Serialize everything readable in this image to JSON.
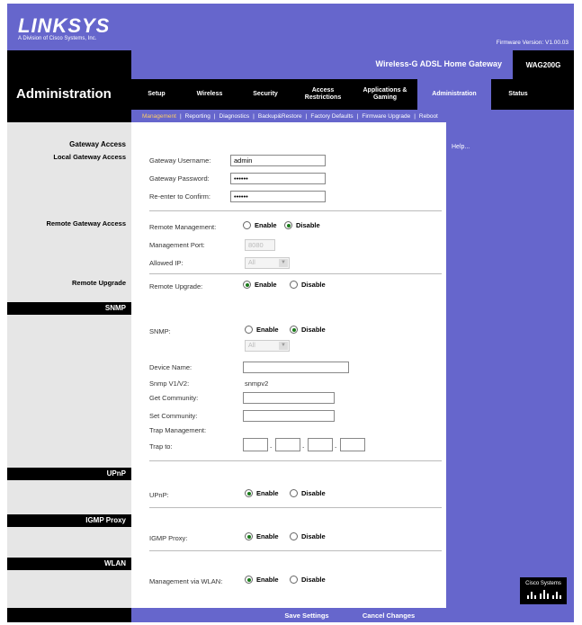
{
  "header": {
    "logo": "LINKSYS",
    "logo_sub": "A Division of Cisco Systems, Inc.",
    "firmware": "Firmware Version: V1.00.03",
    "product_name": "Wireless-G ADSL Home Gateway",
    "model": "WAG200G",
    "page_title": "Administration"
  },
  "tabs": [
    {
      "label": "Setup"
    },
    {
      "label": "Wireless"
    },
    {
      "label": "Security"
    },
    {
      "label": "Access Restrictions"
    },
    {
      "label": "Applications & Gaming"
    },
    {
      "label": "Administration"
    },
    {
      "label": "Status"
    }
  ],
  "subtabs": [
    {
      "label": "Management"
    },
    {
      "label": "Reporting"
    },
    {
      "label": "Diagnostics"
    },
    {
      "label": "Backup&Restore"
    },
    {
      "label": "Factory Defaults"
    },
    {
      "label": "Firmware Upgrade"
    },
    {
      "label": "Reboot"
    }
  ],
  "sidebar": {
    "gateway_access": "Gateway Access",
    "local_gateway_access": "Local Gateway Access",
    "remote_gateway_access": "Remote Gateway Access",
    "remote_upgrade": "Remote Upgrade",
    "snmp": "SNMP",
    "upnp": "UPnP",
    "igmp_proxy": "IGMP Proxy",
    "wlan": "WLAN"
  },
  "form": {
    "username_label": "Gateway Username:",
    "username_value": "admin",
    "password_label": "Gateway Password:",
    "password_value": "••••••",
    "confirm_label": "Re-enter to Confirm:",
    "confirm_value": "••••••",
    "remote_mgmt_label": "Remote Management:",
    "enable": "Enable",
    "disable": "Disable",
    "mgmt_port_label": "Management Port:",
    "mgmt_port_value": "8080",
    "allowed_ip_label": "Allowed IP:",
    "allowed_ip_value": "All",
    "remote_upgrade_label": "Remote Upgrade:",
    "snmp_label": "SNMP:",
    "snmp_select": "All",
    "device_name_label": "Device Name:",
    "snmp_version_label": "Snmp V1/V2:",
    "snmp_version_value": "snmpv2",
    "get_community_label": "Get Community:",
    "set_community_label": "Set Community:",
    "trap_mgmt_label": "Trap Management:",
    "trap_to_label": "Trap to:",
    "upnp_label": "UPnP:",
    "igmp_label": "IGMP Proxy:",
    "mgmt_wlan_label": "Management via WLAN:"
  },
  "help": "Help...",
  "cisco": "Cisco Systems",
  "footer": {
    "save": "Save Settings",
    "cancel": "Cancel Changes"
  }
}
